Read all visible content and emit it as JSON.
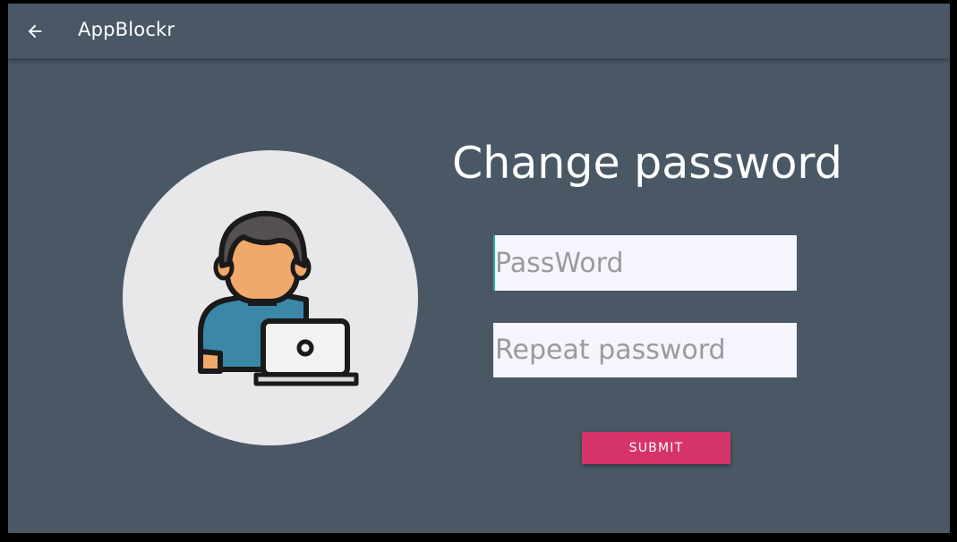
{
  "appbar": {
    "back_icon": "arrow-left-icon",
    "title": "AppBlockr"
  },
  "main": {
    "illustration": "user-with-laptop-icon",
    "title": "Change password",
    "password_placeholder": "PassWord",
    "repeat_placeholder": "Repeat password",
    "submit_label": "SUBMIT"
  },
  "colors": {
    "background": "#4a5866",
    "submit": "#d6336b",
    "field": "#f5f6fd",
    "cursor": "#2bb3a0"
  }
}
